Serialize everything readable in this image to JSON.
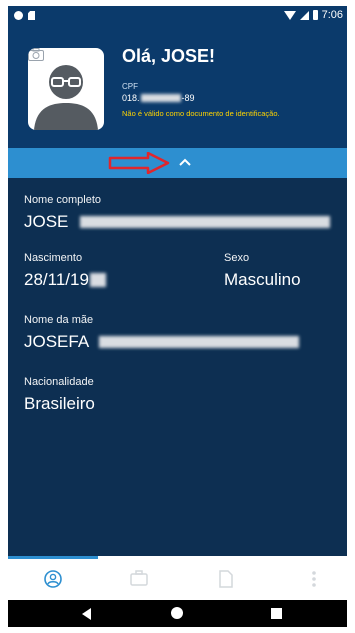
{
  "status_bar": {
    "time": "7:06"
  },
  "header": {
    "greeting": "Olá, JOSE!",
    "cpf_label": "CPF",
    "cpf_prefix": "018.",
    "cpf_suffix": "-89",
    "warning": "Não é válido como documento de identificação."
  },
  "details": {
    "full_name_label": "Nome completo",
    "full_name_value": "JOSE",
    "birth_label": "Nascimento",
    "birth_value": "28/11/19",
    "sex_label": "Sexo",
    "sex_value": "Masculino",
    "mother_label": "Nome da mãe",
    "mother_value": "JOSEFA",
    "nationality_label": "Nacionalidade",
    "nationality_value": "Brasileiro"
  },
  "bottom_nav": {
    "items": [
      {
        "icon": "profile-icon",
        "active": true
      },
      {
        "icon": "briefcase-icon",
        "active": false
      },
      {
        "icon": "document-icon",
        "active": false
      },
      {
        "icon": "more-icon",
        "active": false
      }
    ]
  },
  "colors": {
    "header_bg": "#0b3a6b",
    "body_bg": "#0d2f52",
    "accent": "#2d8fd0",
    "warning": "#ffd400",
    "annotation_arrow": "#e0262c"
  }
}
